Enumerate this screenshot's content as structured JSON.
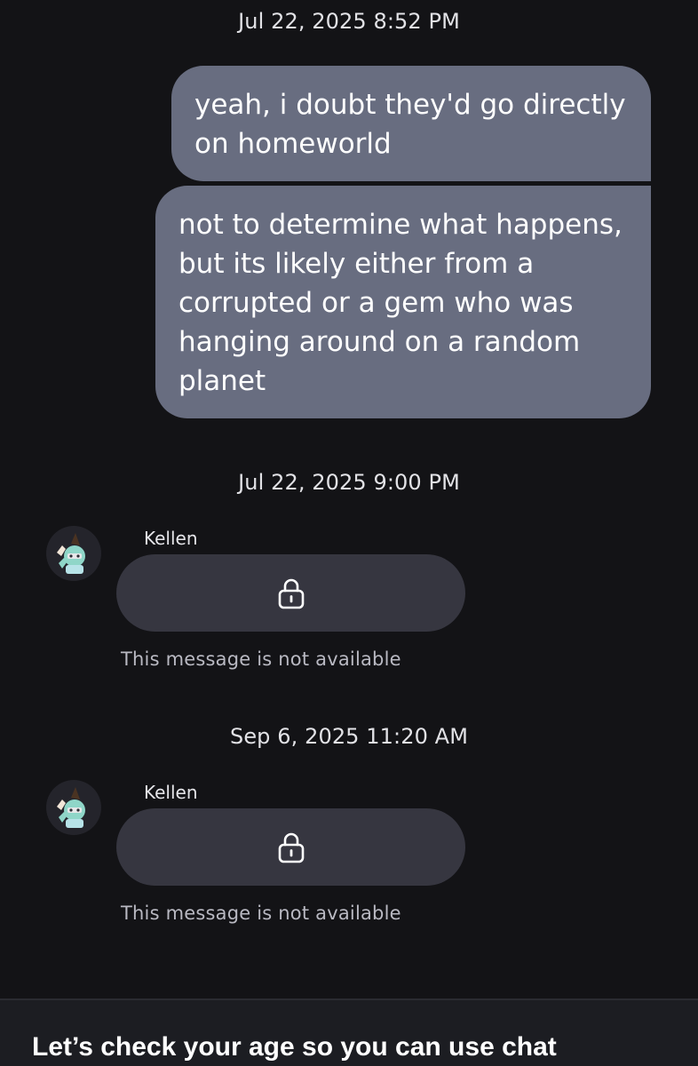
{
  "conversation": {
    "blocks": [
      {
        "timestamp": "Jul 22, 2025 8:52 PM",
        "outgoing": [
          "yeah, i doubt they'd go directly on homeworld",
          "not to determine what happens, but its likely either from a corrupted or a gem who was hanging around on a random planet"
        ]
      },
      {
        "timestamp": "Jul 22, 2025 9:00 PM",
        "sender": "Kellen",
        "icon": "lock-icon",
        "status": "This message is not available"
      },
      {
        "timestamp": "Sep 6, 2025 11:20 AM",
        "sender": "Kellen",
        "icon": "lock-icon",
        "status": "This message is not available"
      }
    ]
  },
  "age_check": {
    "title": "Let’s check your age so you can use chat"
  },
  "colors": {
    "background": "#131316",
    "outgoing_bubble": "#686d80",
    "incoming_bubble": "#363640",
    "banner": "#1c1d22"
  }
}
